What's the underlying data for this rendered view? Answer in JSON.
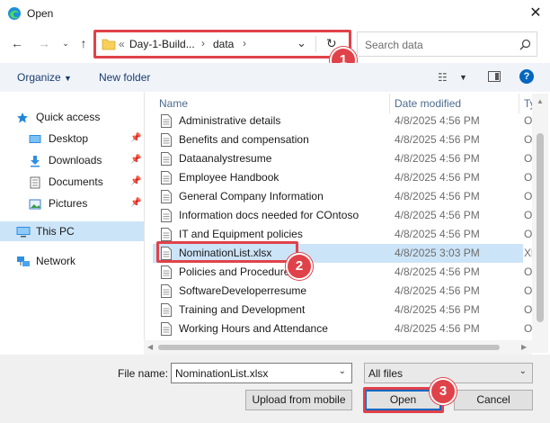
{
  "window": {
    "title": "Open"
  },
  "address": {
    "overflow": "«",
    "segments": [
      "Day-1-Build...",
      "data"
    ]
  },
  "search": {
    "placeholder": "Search data"
  },
  "toolbar": {
    "organize_label": "Organize",
    "new_folder_label": "New folder"
  },
  "nav": [
    {
      "label": "Quick access",
      "icon": "star-icon",
      "pinned": false,
      "selected": false
    },
    {
      "label": "Desktop",
      "icon": "desktop-icon",
      "pinned": true,
      "selected": false
    },
    {
      "label": "Downloads",
      "icon": "download-icon",
      "pinned": true,
      "selected": false
    },
    {
      "label": "Documents",
      "icon": "documents-icon",
      "pinned": true,
      "selected": false
    },
    {
      "label": "Pictures",
      "icon": "pictures-icon",
      "pinned": true,
      "selected": false
    },
    {
      "label": "This PC",
      "icon": "pc-icon",
      "pinned": false,
      "selected": true
    },
    {
      "label": "Network",
      "icon": "network-icon",
      "pinned": false,
      "selected": false
    }
  ],
  "columns": {
    "name": "Name",
    "date": "Date modified",
    "type": "Ty"
  },
  "files": [
    {
      "name": "Administrative details",
      "date": "4/8/2025 4:56 PM",
      "type": "O"
    },
    {
      "name": "Benefits and compensation",
      "date": "4/8/2025 4:56 PM",
      "type": "O"
    },
    {
      "name": "Dataanalystresume",
      "date": "4/8/2025 4:56 PM",
      "type": "O"
    },
    {
      "name": "Employee Handbook",
      "date": "4/8/2025 4:56 PM",
      "type": "O"
    },
    {
      "name": "General Company Information",
      "date": "4/8/2025 4:56 PM",
      "type": "O"
    },
    {
      "name": "Information docs needed for COntoso",
      "date": "4/8/2025 4:56 PM",
      "type": "O"
    },
    {
      "name": "IT and Equipment policies",
      "date": "4/8/2025 4:56 PM",
      "type": "O"
    },
    {
      "name": "NominationList.xlsx",
      "date": "4/8/2025 3:03 PM",
      "type": "Xl"
    },
    {
      "name": "Policies and Procedures",
      "date": "4/8/2025 4:56 PM",
      "type": "O"
    },
    {
      "name": "SoftwareDeveloperresume",
      "date": "4/8/2025 4:56 PM",
      "type": "O"
    },
    {
      "name": "Training and Development",
      "date": "4/8/2025 4:56 PM",
      "type": "O"
    },
    {
      "name": "Working Hours and Attendance",
      "date": "4/8/2025 4:56 PM",
      "type": "O"
    }
  ],
  "bottom": {
    "file_name_label": "File name:",
    "file_name_value": "NominationList.xlsx",
    "file_type_value": "All files",
    "upload_label": "Upload from mobile",
    "open_label": "Open",
    "cancel_label": "Cancel"
  },
  "callouts": [
    "1",
    "2",
    "3"
  ],
  "colors": {
    "callout": "#e0424a",
    "selection": "#cce4f7",
    "accent": "#0067c0"
  }
}
